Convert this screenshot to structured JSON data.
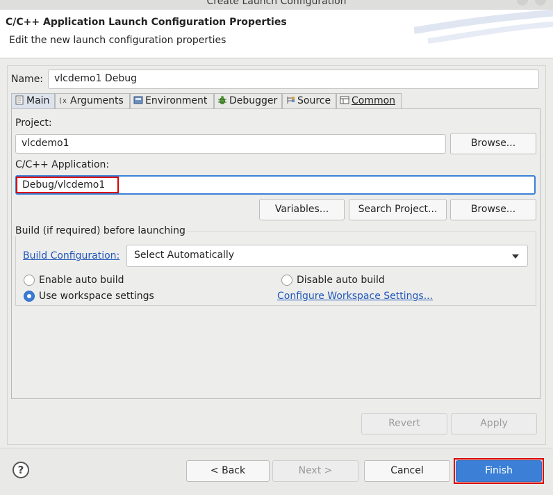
{
  "window": {
    "title": "Create Launch Configuration"
  },
  "header": {
    "title": "C/C++ Application Launch Configuration Properties",
    "subtitle": "Edit the new launch configuration properties"
  },
  "name_field": {
    "label": "Name:",
    "value": "vlcdemo1 Debug"
  },
  "tabs": [
    {
      "label": "Main",
      "icon": "page-icon",
      "active": true
    },
    {
      "label": "Arguments",
      "icon": "arguments-icon",
      "active": false
    },
    {
      "label": "Environment",
      "icon": "environment-icon",
      "active": false
    },
    {
      "label": "Debugger",
      "icon": "bug-icon",
      "active": false
    },
    {
      "label": "Source",
      "icon": "source-icon",
      "active": false
    },
    {
      "label": "Common",
      "icon": "common-icon",
      "active": false
    }
  ],
  "main": {
    "project_label": "Project:",
    "project_value": "vlcdemo1",
    "browse_label": "Browse...",
    "application_label": "C/C++ Application:",
    "application_value": "Debug/vlcdemo1",
    "variables_label": "Variables...",
    "search_project_label": "Search Project...",
    "browse2_label": "Browse...",
    "build": {
      "group_label": "Build (if required) before launching",
      "config_link": "Build Configuration:",
      "config_value": "Select Automatically",
      "enable_auto_build": "Enable auto build",
      "disable_auto_build": "Disable auto build",
      "use_workspace": "Use workspace settings",
      "configure_link": "Configure Workspace Settings...",
      "selected": "use_workspace"
    }
  },
  "actions": {
    "revert": "Revert",
    "apply": "Apply"
  },
  "footer": {
    "help": "?",
    "back": "< Back",
    "next": "Next >",
    "cancel": "Cancel",
    "finish": "Finish"
  },
  "colors": {
    "accent": "#3b80d6",
    "highlight": "#d80000",
    "link": "#1f56b8"
  }
}
